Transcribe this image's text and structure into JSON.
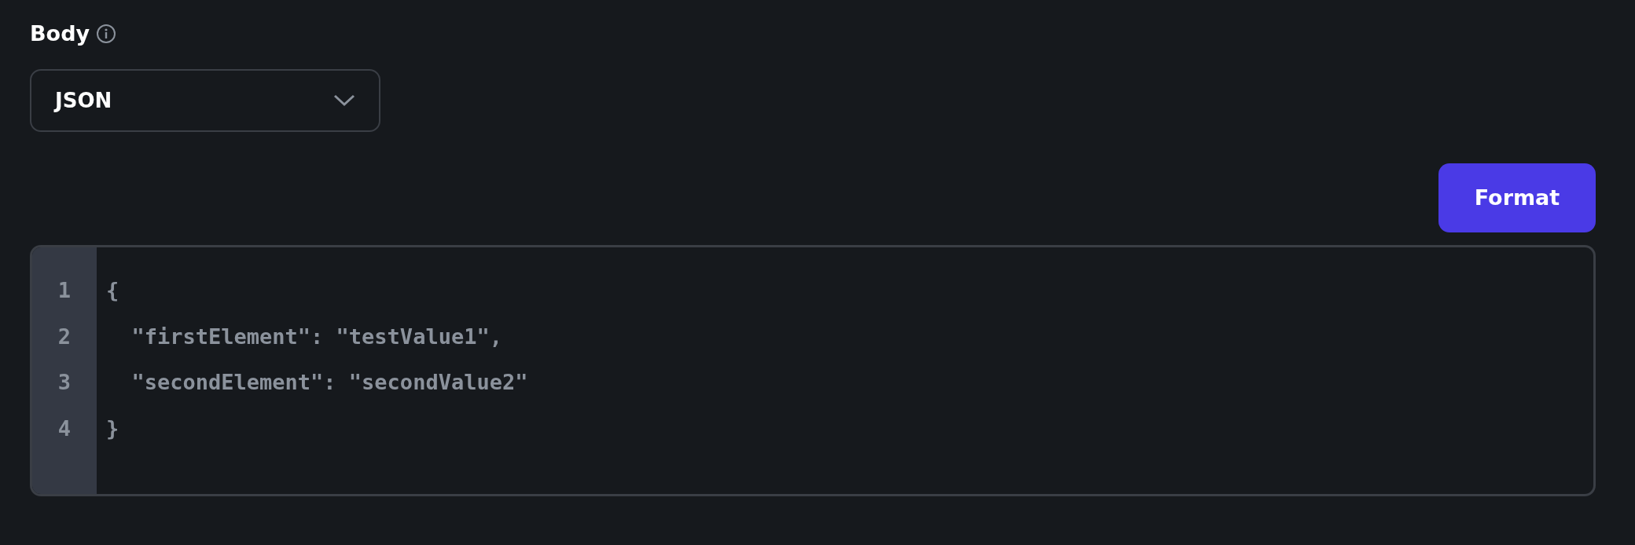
{
  "section": {
    "title": "Body"
  },
  "body_type": {
    "value": "JSON"
  },
  "format_button": {
    "label": "Format"
  },
  "editor": {
    "lines": [
      {
        "number": "1",
        "code": "{"
      },
      {
        "number": "2",
        "code": "  \"firstElement\": \"testValue1\","
      },
      {
        "number": "3",
        "code": "  \"secondElement\": \"secondValue2\""
      },
      {
        "number": "4",
        "code": "}"
      }
    ]
  }
}
